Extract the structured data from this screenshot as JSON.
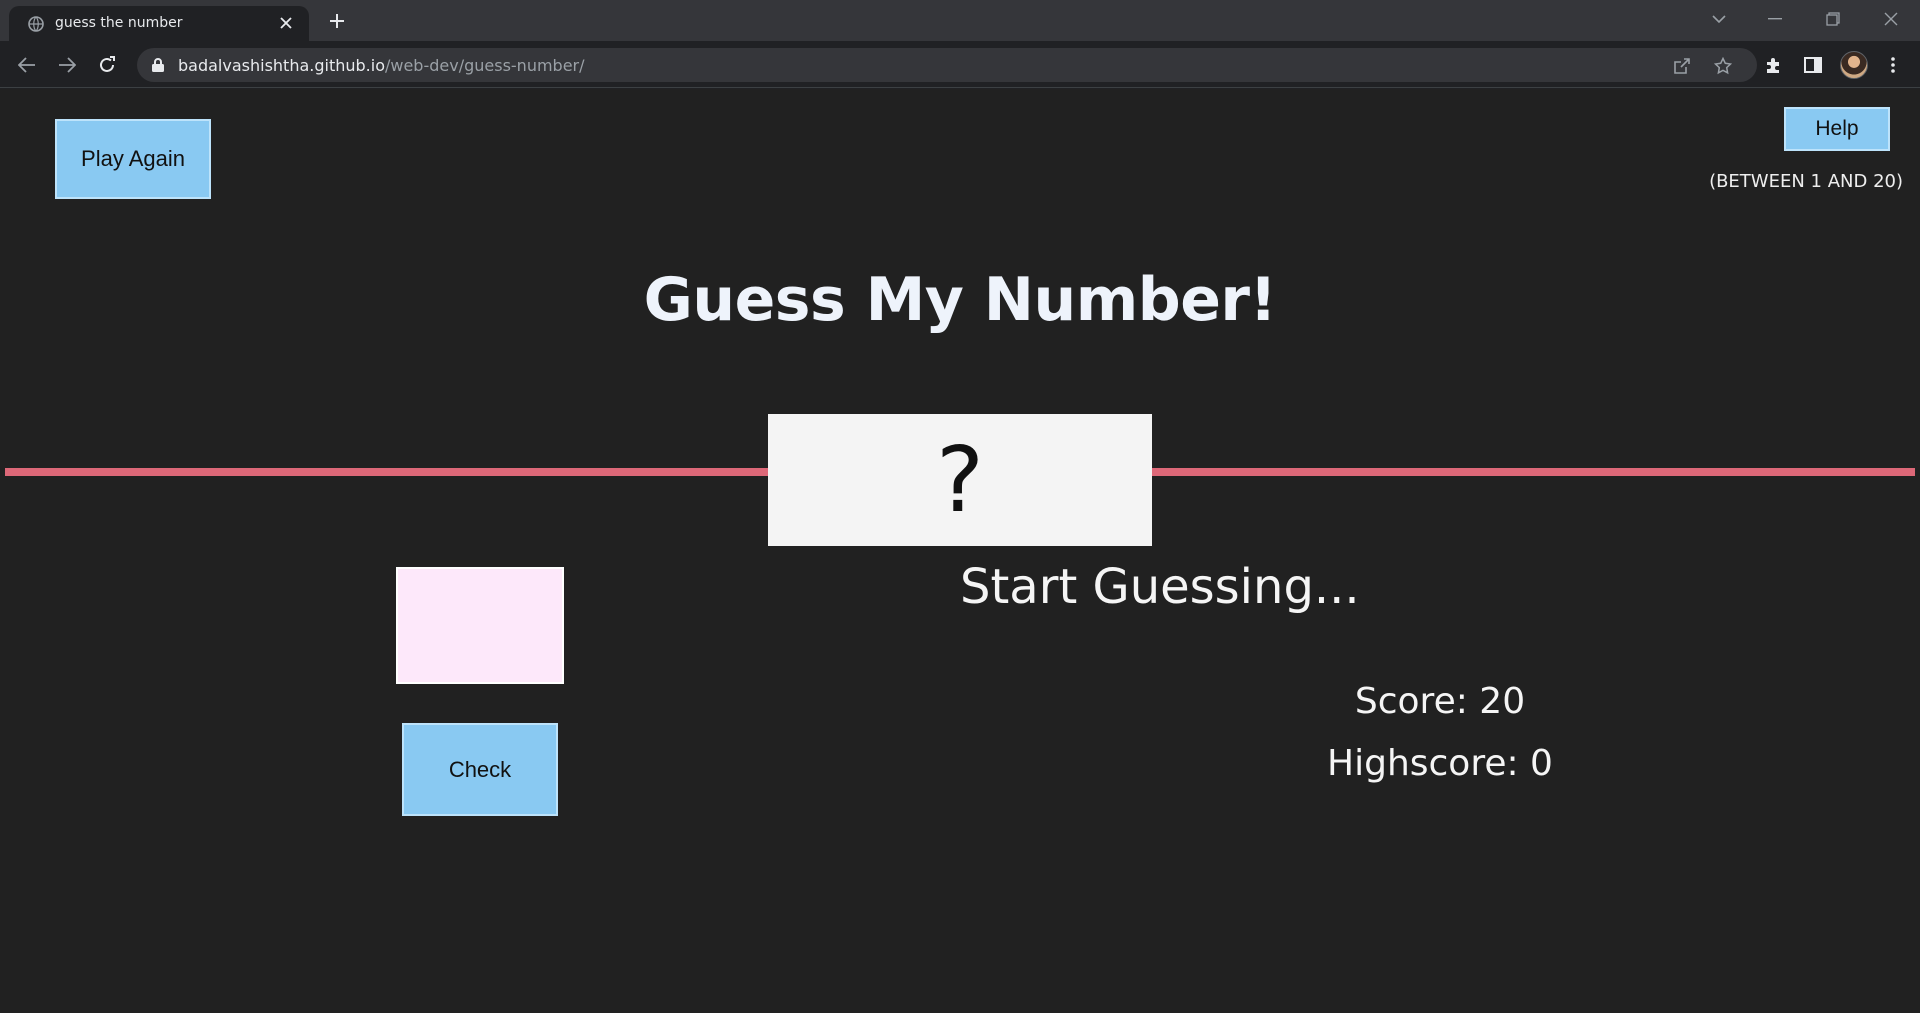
{
  "browser": {
    "tab": {
      "title": "guess the number"
    },
    "address": {
      "host": "badalvashishtha.github.io",
      "path": "/web-dev/guess-number/"
    }
  },
  "game": {
    "play_again_label": "Play Again",
    "help_label": "Help",
    "range_hint": "(BETWEEN 1 AND 20)",
    "title": "Guess My Number!",
    "secret_display": "?",
    "guess_value": "",
    "check_label": "Check",
    "message": "Start Guessing...",
    "score_text": "Score: 20",
    "highscore_text": "Highscore: 0"
  },
  "colors": {
    "page_bg": "#212121",
    "button_bg": "#89c9f2",
    "divider": "#dd6878",
    "number_box_bg": "#f4f4f4",
    "input_bg": "#fde8fa",
    "title_text": "#eef3fb"
  }
}
